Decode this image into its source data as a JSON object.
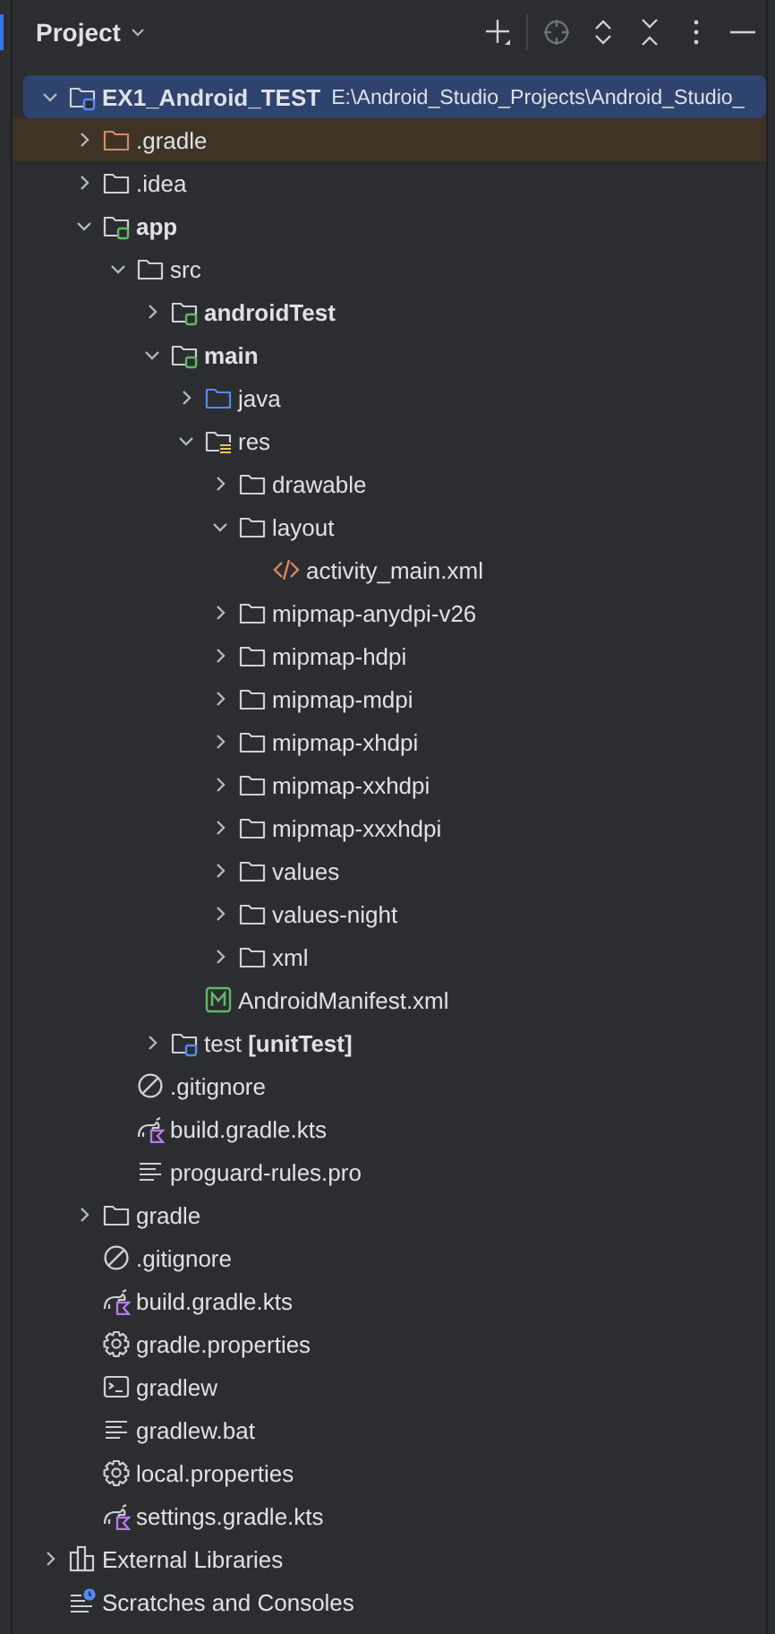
{
  "panel": {
    "title": "Project"
  },
  "tree": [
    {
      "label": "EX1_Android_TEST",
      "path": "E:\\Android_Studio_Projects\\Android_Studio_",
      "kind": "root-module",
      "bold": true,
      "selected": true,
      "excluded": false,
      "expanded": true,
      "children": [
        {
          "label": ".gradle",
          "kind": "folder",
          "selected": false,
          "excluded": true,
          "expanded": false
        },
        {
          "label": ".idea",
          "kind": "folder",
          "selected": false,
          "excluded": false,
          "expanded": false
        },
        {
          "label": "app",
          "kind": "module",
          "bold": true,
          "selected": false,
          "excluded": false,
          "expanded": true,
          "children": [
            {
              "label": "src",
              "kind": "folder",
              "selected": false,
              "excluded": false,
              "expanded": true,
              "children": [
                {
                  "label": "androidTest",
                  "kind": "module",
                  "bold": true,
                  "selected": false,
                  "excluded": false,
                  "expanded": false
                },
                {
                  "label": "main",
                  "kind": "module",
                  "bold": true,
                  "selected": false,
                  "excluded": false,
                  "expanded": true,
                  "children": [
                    {
                      "label": "java",
                      "kind": "source-folder",
                      "selected": false,
                      "excluded": false,
                      "expanded": false
                    },
                    {
                      "label": "res",
                      "kind": "resources",
                      "selected": false,
                      "excluded": false,
                      "expanded": true,
                      "children": [
                        {
                          "label": "drawable",
                          "kind": "folder",
                          "selected": false,
                          "excluded": false,
                          "expanded": false
                        },
                        {
                          "label": "layout",
                          "kind": "folder",
                          "selected": false,
                          "excluded": false,
                          "expanded": true,
                          "children": [
                            {
                              "label": "activity_main.xml",
                              "kind": "xml",
                              "selected": false,
                              "excluded": false
                            }
                          ]
                        },
                        {
                          "label": "mipmap-anydpi-v26",
                          "kind": "folder",
                          "selected": false,
                          "excluded": false,
                          "expanded": false
                        },
                        {
                          "label": "mipmap-hdpi",
                          "kind": "folder",
                          "selected": false,
                          "excluded": false,
                          "expanded": false
                        },
                        {
                          "label": "mipmap-mdpi",
                          "kind": "folder",
                          "selected": false,
                          "excluded": false,
                          "expanded": false
                        },
                        {
                          "label": "mipmap-xhdpi",
                          "kind": "folder",
                          "selected": false,
                          "excluded": false,
                          "expanded": false
                        },
                        {
                          "label": "mipmap-xxhdpi",
                          "kind": "folder",
                          "selected": false,
                          "excluded": false,
                          "expanded": false
                        },
                        {
                          "label": "mipmap-xxxhdpi",
                          "kind": "folder",
                          "selected": false,
                          "excluded": false,
                          "expanded": false
                        },
                        {
                          "label": "values",
                          "kind": "folder",
                          "selected": false,
                          "excluded": false,
                          "expanded": false
                        },
                        {
                          "label": "values-night",
                          "kind": "folder",
                          "selected": false,
                          "excluded": false,
                          "expanded": false
                        },
                        {
                          "label": "xml",
                          "kind": "folder",
                          "selected": false,
                          "excluded": false,
                          "expanded": false
                        }
                      ]
                    },
                    {
                      "label": "AndroidManifest.xml",
                      "kind": "manifest",
                      "selected": false,
                      "excluded": false
                    }
                  ]
                },
                {
                  "label": "test **[unitTest]**",
                  "kind": "test-module",
                  "selected": false,
                  "excluded": false,
                  "expanded": false
                }
              ]
            },
            {
              "label": ".gitignore",
              "kind": "ignore",
              "selected": false,
              "excluded": false
            },
            {
              "label": "build.gradle.kts",
              "kind": "gradle-kts",
              "selected": false,
              "excluded": false
            },
            {
              "label": "proguard-rules.pro",
              "kind": "text",
              "selected": false,
              "excluded": false
            }
          ]
        },
        {
          "label": "gradle",
          "kind": "folder",
          "selected": false,
          "excluded": false,
          "expanded": false
        },
        {
          "label": ".gitignore",
          "kind": "ignore",
          "selected": false,
          "excluded": false
        },
        {
          "label": "build.gradle.kts",
          "kind": "gradle-kts",
          "selected": false,
          "excluded": false
        },
        {
          "label": "gradle.properties",
          "kind": "gear",
          "selected": false,
          "excluded": false
        },
        {
          "label": "gradlew",
          "kind": "terminal",
          "selected": false,
          "excluded": false
        },
        {
          "label": "gradlew.bat",
          "kind": "text",
          "selected": false,
          "excluded": false
        },
        {
          "label": "local.properties",
          "kind": "gear",
          "selected": false,
          "excluded": false
        },
        {
          "label": "settings.gradle.kts",
          "kind": "gradle-kts",
          "selected": false,
          "excluded": false
        }
      ]
    },
    {
      "label": "External Libraries",
      "kind": "libraries",
      "selected": false,
      "excluded": false,
      "expanded": false
    },
    {
      "label": "Scratches and Consoles",
      "kind": "scratches",
      "selected": false,
      "excluded": false
    }
  ]
}
